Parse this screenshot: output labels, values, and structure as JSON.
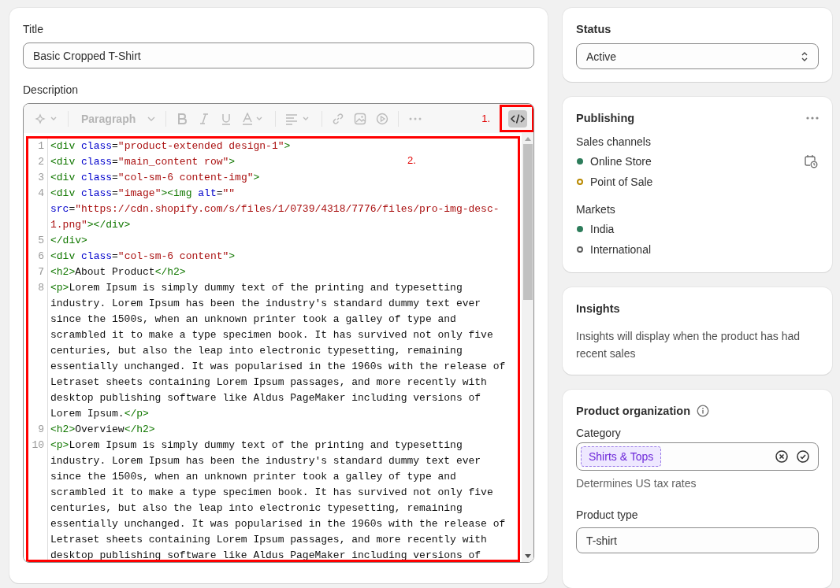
{
  "main_card": {
    "title_label": "Title",
    "title_value": "Basic Cropped T-Shirt",
    "description_label": "Description",
    "toolbar": {
      "block_style": "Paragraph",
      "annotation": "1."
    },
    "editor": {
      "annotation": "2.",
      "lines": [
        {
          "number": "1",
          "rows": [
            "<div class=\"product-extended design-1\">"
          ]
        },
        {
          "number": "2",
          "rows": [
            "<div class=\"main_content row\">"
          ]
        },
        {
          "number": "3",
          "rows": [
            "<div class=\"col-sm-6 content-img\">"
          ]
        },
        {
          "number": "4",
          "rows": [
            "<div class=\"image\"><img alt=\"\"",
            "src=\"https://cdn.shopify.com/s/files/1/0739/4318/7776/files/pro-img-desc-",
            "1.png\"></div>"
          ]
        },
        {
          "number": "5",
          "rows": [
            "</div>"
          ]
        },
        {
          "number": "6",
          "rows": [
            "<div class=\"col-sm-6 content\">"
          ]
        },
        {
          "number": "7",
          "rows": [
            "<h2>About Product</h2>"
          ]
        },
        {
          "number": "8",
          "rows": [
            "<p>Lorem Ipsum is simply dummy text of the printing and typesetting",
            "industry. Lorem Ipsum has been the industry's standard dummy text ever",
            "since the 1500s, when an unknown printer took a galley of type and",
            "scrambled it to make a type specimen book. It has survived not only five",
            "centuries, but also the leap into electronic typesetting, remaining",
            "essentially unchanged. It was popularised in the 1960s with the release of",
            "Letraset sheets containing Lorem Ipsum passages, and more recently with",
            "desktop publishing software like Aldus PageMaker including versions of",
            "Lorem Ipsum.</p>"
          ]
        },
        {
          "number": "9",
          "rows": [
            "<h2>Overview</h2>"
          ]
        },
        {
          "number": "10",
          "rows": [
            "<p>Lorem Ipsum is simply dummy text of the printing and typesetting",
            "industry. Lorem Ipsum has been the industry's standard dummy text ever",
            "since the 1500s, when an unknown printer took a galley of type and",
            "scrambled it to make a type specimen book. It has survived not only five",
            "centuries, but also the leap into electronic typesetting, remaining",
            "essentially unchanged. It was popularised in the 1960s with the release of",
            "Letraset sheets containing Lorem Ipsum passages, and more recently with",
            "desktop publishing software like Aldus PageMaker including versions of"
          ]
        }
      ]
    }
  },
  "status_card": {
    "title": "Status",
    "value": "Active"
  },
  "publishing_card": {
    "title": "Publishing",
    "groups": [
      {
        "heading": "Sales channels",
        "items": [
          {
            "label": "Online Store",
            "color": "#2e7d5b",
            "filled": true
          },
          {
            "label": "Point of Sale",
            "color": "#b98900",
            "filled": false
          }
        ]
      },
      {
        "heading": "Markets",
        "items": [
          {
            "label": "India",
            "color": "#2e7d5b",
            "filled": true
          },
          {
            "label": "International",
            "color": "#616161",
            "filled": false
          }
        ]
      }
    ]
  },
  "insights_card": {
    "title": "Insights",
    "text": "Insights will display when the product has had recent sales"
  },
  "organization_card": {
    "title": "Product organization",
    "category_label": "Category",
    "category_tag": "Shirts & Tops",
    "category_help": "Determines US tax rates",
    "type_label": "Product type",
    "type_value": "T-shirt"
  }
}
